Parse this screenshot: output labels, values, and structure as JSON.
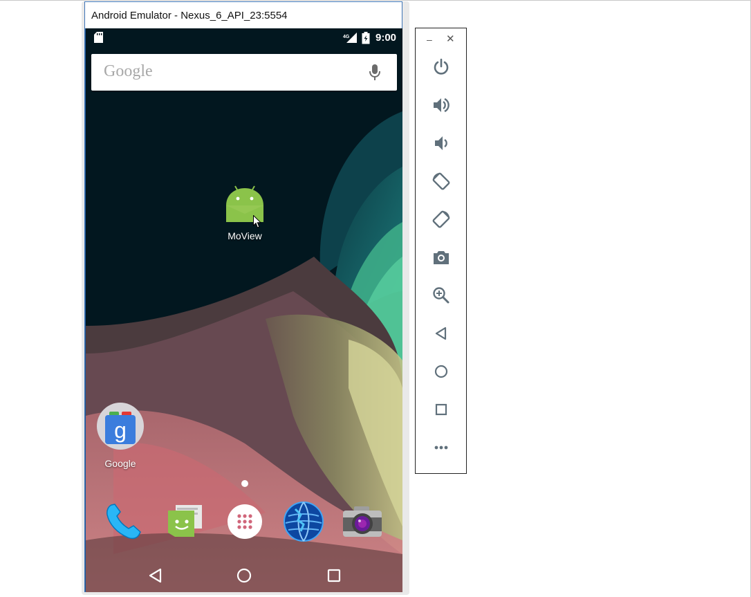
{
  "window": {
    "title": "Android Emulator - Nexus_6_API_23:5554"
  },
  "status_bar": {
    "network_label": "4G",
    "time": "9:00"
  },
  "search_widget": {
    "logo_text": "Google"
  },
  "desktop": {
    "apps": [
      {
        "label": "MoView",
        "icon": "android-app-icon"
      },
      {
        "label": "Google",
        "icon": "google-folder-icon"
      }
    ]
  },
  "dock": {
    "items": [
      {
        "icon": "phone-icon"
      },
      {
        "icon": "messaging-icon"
      },
      {
        "icon": "app-drawer-icon"
      },
      {
        "icon": "browser-icon"
      },
      {
        "icon": "camera-icon"
      }
    ]
  },
  "navigation": {
    "buttons": [
      {
        "icon": "back-icon"
      },
      {
        "icon": "home-icon"
      },
      {
        "icon": "recents-icon"
      }
    ]
  },
  "toolbar": {
    "minimize_label": "–",
    "close_label": "✕",
    "buttons": [
      {
        "icon": "power-icon"
      },
      {
        "icon": "volume-up-icon"
      },
      {
        "icon": "volume-down-icon"
      },
      {
        "icon": "rotate-left-icon"
      },
      {
        "icon": "rotate-right-icon"
      },
      {
        "icon": "screenshot-icon"
      },
      {
        "icon": "zoom-icon"
      },
      {
        "icon": "back-icon"
      },
      {
        "icon": "home-icon"
      },
      {
        "icon": "overview-icon"
      },
      {
        "icon": "more-icon"
      }
    ]
  },
  "colors": {
    "window_border": "#1e5a9c",
    "android_green": "#8bc34a",
    "toolbar_icon": "#60707b"
  }
}
